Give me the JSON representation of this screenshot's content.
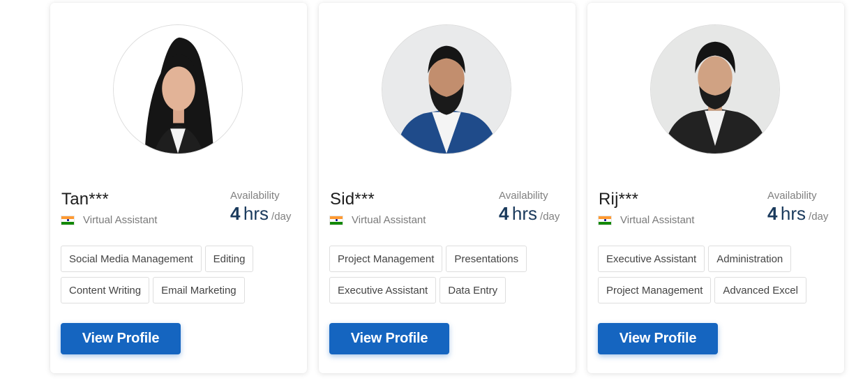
{
  "cards": [
    {
      "name": "Tan***",
      "role": "Virtual Assistant",
      "availability_label": "Availability",
      "availability_value": "4",
      "availability_unit": "hrs",
      "availability_per": "/day",
      "skills": [
        "Social Media Management",
        "Editing",
        "Content Writing",
        "Email Marketing"
      ],
      "button_label": "View Profile"
    },
    {
      "name": "Sid***",
      "role": "Virtual Assistant",
      "availability_label": "Availability",
      "availability_value": "4",
      "availability_unit": "hrs",
      "availability_per": "/day",
      "skills": [
        "Project Management",
        "Presentations",
        "Executive Assistant",
        "Data Entry"
      ],
      "button_label": "View Profile"
    },
    {
      "name": "Rij***",
      "role": "Virtual Assistant",
      "availability_label": "Availability",
      "availability_value": "4",
      "availability_unit": "hrs",
      "availability_per": "/day",
      "skills": [
        "Executive Assistant",
        "Administration",
        "Project Management",
        "Advanced Excel"
      ],
      "button_label": "View Profile"
    }
  ],
  "colors": {
    "primary_button": "#1565c0",
    "availability_value": "#1a3a5c"
  },
  "icons": {
    "flag": "india-flag-icon"
  }
}
